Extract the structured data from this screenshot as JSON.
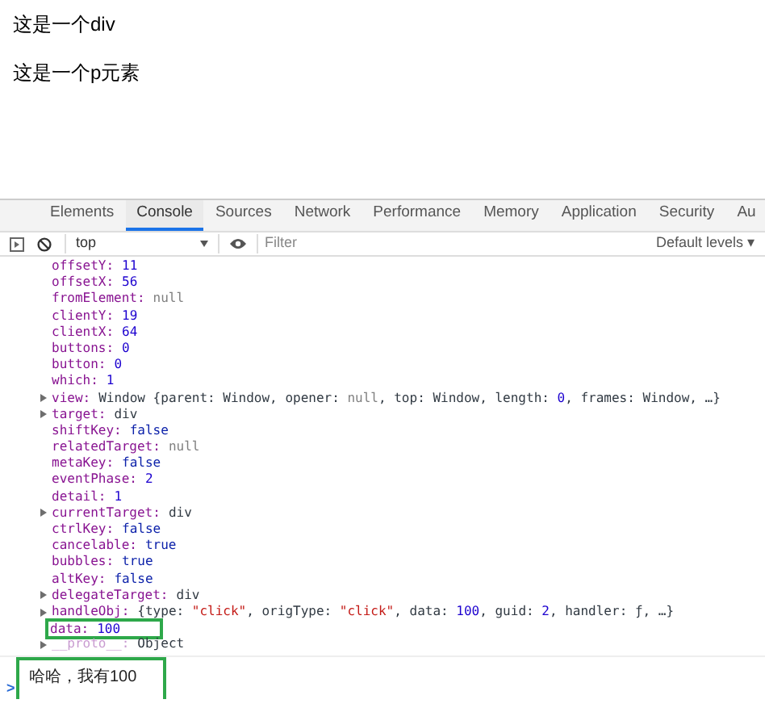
{
  "page": {
    "texts": [
      "这是一个div",
      "这是一个p元素"
    ]
  },
  "devtools": {
    "tabs": [
      {
        "label": "Elements",
        "selected": false
      },
      {
        "label": "Console",
        "selected": true
      },
      {
        "label": "Sources",
        "selected": false
      },
      {
        "label": "Network",
        "selected": false
      },
      {
        "label": "Performance",
        "selected": false
      },
      {
        "label": "Memory",
        "selected": false
      },
      {
        "label": "Application",
        "selected": false
      },
      {
        "label": "Security",
        "selected": false
      },
      {
        "label": "Au",
        "selected": false
      }
    ],
    "toolbar": {
      "context": "top",
      "filter_placeholder": "Filter",
      "levels": "Default levels ▾"
    },
    "console_lines": [
      {
        "key": "offsetY:",
        "expandable": false,
        "dimmed": false,
        "highlighted": false,
        "value": [
          {
            "kind": "number",
            "text": "11"
          }
        ]
      },
      {
        "key": "offsetX:",
        "expandable": false,
        "dimmed": false,
        "highlighted": false,
        "value": [
          {
            "kind": "number",
            "text": "56"
          }
        ]
      },
      {
        "key": "fromElement:",
        "expandable": false,
        "dimmed": false,
        "highlighted": false,
        "value": [
          {
            "kind": "null",
            "text": "null"
          }
        ]
      },
      {
        "key": "clientY:",
        "expandable": false,
        "dimmed": false,
        "highlighted": false,
        "value": [
          {
            "kind": "number",
            "text": "19"
          }
        ]
      },
      {
        "key": "clientX:",
        "expandable": false,
        "dimmed": false,
        "highlighted": false,
        "value": [
          {
            "kind": "number",
            "text": "64"
          }
        ]
      },
      {
        "key": "buttons:",
        "expandable": false,
        "dimmed": false,
        "highlighted": false,
        "value": [
          {
            "kind": "number",
            "text": "0"
          }
        ]
      },
      {
        "key": "button:",
        "expandable": false,
        "dimmed": false,
        "highlighted": false,
        "value": [
          {
            "kind": "number",
            "text": "0"
          }
        ]
      },
      {
        "key": "which:",
        "expandable": false,
        "dimmed": false,
        "highlighted": false,
        "value": [
          {
            "kind": "number",
            "text": "1"
          }
        ]
      },
      {
        "key": "view:",
        "expandable": true,
        "dimmed": false,
        "highlighted": false,
        "value": [
          {
            "kind": "plain",
            "text": "Window {parent: Window, opener: "
          },
          {
            "kind": "null",
            "text": "null"
          },
          {
            "kind": "plain",
            "text": ", top: Window, length: "
          },
          {
            "kind": "number",
            "text": "0"
          },
          {
            "kind": "plain",
            "text": ", frames: Window, …}"
          }
        ]
      },
      {
        "key": "target:",
        "expandable": true,
        "dimmed": false,
        "highlighted": false,
        "value": [
          {
            "kind": "plain",
            "text": "div"
          }
        ]
      },
      {
        "key": "shiftKey:",
        "expandable": false,
        "dimmed": false,
        "highlighted": false,
        "value": [
          {
            "kind": "bool",
            "text": "false"
          }
        ]
      },
      {
        "key": "relatedTarget:",
        "expandable": false,
        "dimmed": false,
        "highlighted": false,
        "value": [
          {
            "kind": "null",
            "text": "null"
          }
        ]
      },
      {
        "key": "metaKey:",
        "expandable": false,
        "dimmed": false,
        "highlighted": false,
        "value": [
          {
            "kind": "bool",
            "text": "false"
          }
        ]
      },
      {
        "key": "eventPhase:",
        "expandable": false,
        "dimmed": false,
        "highlighted": false,
        "value": [
          {
            "kind": "number",
            "text": "2"
          }
        ]
      },
      {
        "key": "detail:",
        "expandable": false,
        "dimmed": false,
        "highlighted": false,
        "value": [
          {
            "kind": "number",
            "text": "1"
          }
        ]
      },
      {
        "key": "currentTarget:",
        "expandable": true,
        "dimmed": false,
        "highlighted": false,
        "value": [
          {
            "kind": "plain",
            "text": "div"
          }
        ]
      },
      {
        "key": "ctrlKey:",
        "expandable": false,
        "dimmed": false,
        "highlighted": false,
        "value": [
          {
            "kind": "bool",
            "text": "false"
          }
        ]
      },
      {
        "key": "cancelable:",
        "expandable": false,
        "dimmed": false,
        "highlighted": false,
        "value": [
          {
            "kind": "bool",
            "text": "true"
          }
        ]
      },
      {
        "key": "bubbles:",
        "expandable": false,
        "dimmed": false,
        "highlighted": false,
        "value": [
          {
            "kind": "bool",
            "text": "true"
          }
        ]
      },
      {
        "key": "altKey:",
        "expandable": false,
        "dimmed": false,
        "highlighted": false,
        "value": [
          {
            "kind": "bool",
            "text": "false"
          }
        ]
      },
      {
        "key": "delegateTarget:",
        "expandable": true,
        "dimmed": false,
        "highlighted": false,
        "value": [
          {
            "kind": "plain",
            "text": "div"
          }
        ]
      },
      {
        "key": "handleObj:",
        "expandable": true,
        "dimmed": false,
        "highlighted": false,
        "value": [
          {
            "kind": "plain",
            "text": "{type: "
          },
          {
            "kind": "string",
            "text": "\"click\""
          },
          {
            "kind": "plain",
            "text": ", origType: "
          },
          {
            "kind": "string",
            "text": "\"click\""
          },
          {
            "kind": "plain",
            "text": ", data: "
          },
          {
            "kind": "number",
            "text": "100"
          },
          {
            "kind": "plain",
            "text": ", guid: "
          },
          {
            "kind": "number",
            "text": "2"
          },
          {
            "kind": "plain",
            "text": ", handler: ƒ, …}"
          }
        ]
      },
      {
        "key": "data:",
        "expandable": false,
        "dimmed": false,
        "highlighted": true,
        "value": [
          {
            "kind": "number",
            "text": "100"
          }
        ]
      },
      {
        "key": "__proto__:",
        "expandable": true,
        "dimmed": true,
        "highlighted": false,
        "value": [
          {
            "kind": "plain",
            "text": "Object"
          }
        ]
      }
    ],
    "output": {
      "text": "哈哈，我有100",
      "highlighted": true
    },
    "prompt": ">"
  }
}
